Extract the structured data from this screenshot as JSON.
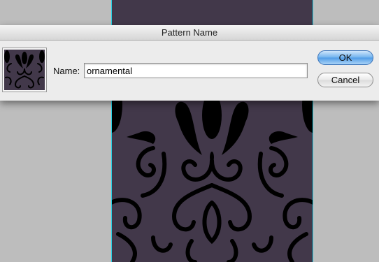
{
  "dialog": {
    "title": "Pattern Name",
    "name_label": "Name:",
    "name_value": "ornamental",
    "ok_label": "OK",
    "cancel_label": "Cancel"
  },
  "colors": {
    "pattern_background": "#42384a",
    "pattern_ink": "#000000",
    "guide": "#27d3e6",
    "default_button": "#6fb2ee"
  },
  "icons": {
    "pattern_thumbnail": "damask-pattern-swatch"
  }
}
